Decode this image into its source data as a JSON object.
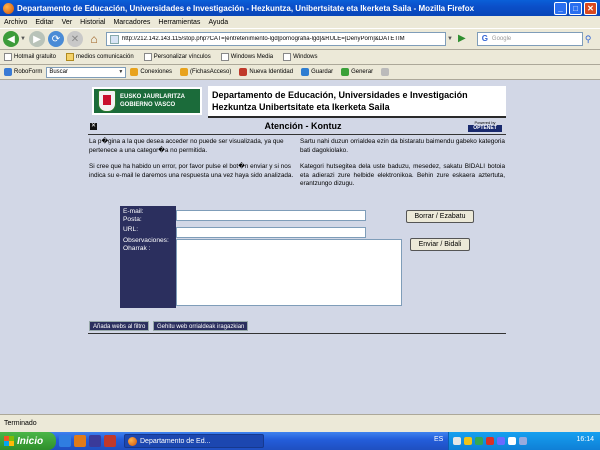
{
  "window": {
    "title": "Departamento de Educación, Universidades e Investigación - Hezkuntza, Unibertsitate eta Ikerketa Saila - Mozilla Firefox",
    "minimize": "_",
    "maximize": "□",
    "close": "✕"
  },
  "menu": [
    "Archivo",
    "Editar",
    "Ver",
    "Historial",
    "Marcadores",
    "Herramientas",
    "Ayuda"
  ],
  "nav": {
    "url": "http://212.142.143.115/stop.php?CAT=[entretenimiento-lgd|pornografia-lgd]&RULE=[DenyPorn]&DATETIM",
    "search_placeholder": "Google"
  },
  "bookmarks": [
    "Hotmail gratuito",
    "medios comunicación",
    "Personalizar vínculos",
    "Windows Media",
    "Windows"
  ],
  "extra_toolbar": {
    "roboform": "RoboForm",
    "search_combo": "Buscar",
    "conexiones": "Conexiones",
    "fichas": "(FichasAcceso)",
    "nueva_identidad": "Nueva Identidad",
    "guardar": "Guardar",
    "generar": "Generar"
  },
  "page": {
    "logo_line1": "EUSKO JAURLARITZA",
    "logo_line2": "GOBIERNO VASCO",
    "header_es": "Departamento de Educación, Universidades e Investigación",
    "header_eu": "Hezkuntza Unibertsitate eta Ikerketa Saila",
    "close_mark": "✕",
    "attention_title": "Atención - Kontuz",
    "powered_by": "Powered by",
    "powered_brand": "OPTENET",
    "msg_es_1": "La p�gina a la que desea acceder no puede ser visualizada, ya que pertenece a una categor�a no permitida.",
    "msg_es_2": "Si cree que ha habido un error, por favor pulse el bot�n enviar y si nos indica su e-mail le daremos una respuesta una vez haya sido analizada.",
    "msg_eu_1": "Sartu nahi duzun orrialdea ezin da bistaratu baimendu gabeko kategoria bati dagokiolako.",
    "msg_eu_2": "Kategori hutsegitea dela uste baduzu, mesedez, sakatu BIDALI botoia eta adierazi zure helbide elektronikoa. Behin zure eskaera aztertuta, erantzungo dizugu.",
    "label_email": "E-mail:",
    "label_posta": "Posta:",
    "label_url": "URL:",
    "label_obs": "Observaciones:",
    "label_oharrak": "Oharrak :",
    "reset_button": "Borrar / Ezabatu",
    "send_button": "Enviar / Bidali",
    "tab_add_es": "Añada webs al filtro",
    "tab_add_eu": "Gehitu web orrialdeak iragazkian"
  },
  "status": "Terminado",
  "taskbar": {
    "start": "Inicio",
    "task": "Departamento de Ed...",
    "lang": "ES",
    "clock": "16:14"
  }
}
